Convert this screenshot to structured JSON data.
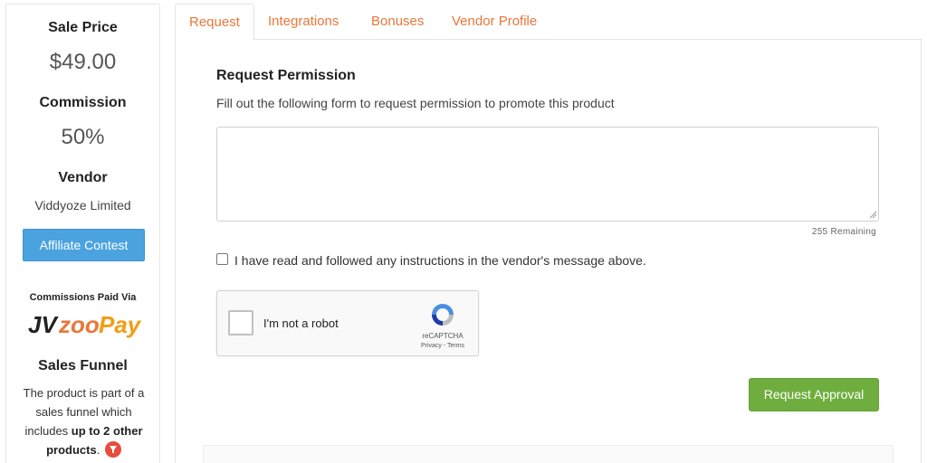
{
  "sidebar": {
    "sale_price_label": "Sale Price",
    "sale_price_value": "$49.00",
    "commission_label": "Commission",
    "commission_value": "50%",
    "vendor_label": "Vendor",
    "vendor_name": "Viddyoze Limited",
    "contest_button": "Affiliate Contest",
    "paid_via_label": "Commissions Paid Via",
    "paid_via_logo": "JVZooPay",
    "funnel_label": "Sales Funnel",
    "funnel_text_1": "The product is part of a sales funnel which includes ",
    "funnel_text_bold": "up to 2 other products",
    "funnel_text_2": ".",
    "funnel_icon": "funnel-icon"
  },
  "tabs": [
    "Request",
    "Integrations",
    "Bonuses",
    "Vendor Profile"
  ],
  "active_tab": "Request",
  "form": {
    "title": "Request Permission",
    "description": "Fill out the following form to request permission to promote this product",
    "textarea_value": "",
    "remaining_text": "255 Remaining",
    "ack_label": "I have read and followed any instructions in the vendor's message above.",
    "ack_checked": false
  },
  "captcha": {
    "label": "I'm not a robot",
    "brand": "reCAPTCHA",
    "links": "Privacy - Terms"
  },
  "submit_button": "Request Approval",
  "colors": {
    "tab_text": "#e8773a",
    "contest_button": "#4aa3df",
    "approve_button": "#6fae3e",
    "funnel_icon": "#e74c3c"
  }
}
